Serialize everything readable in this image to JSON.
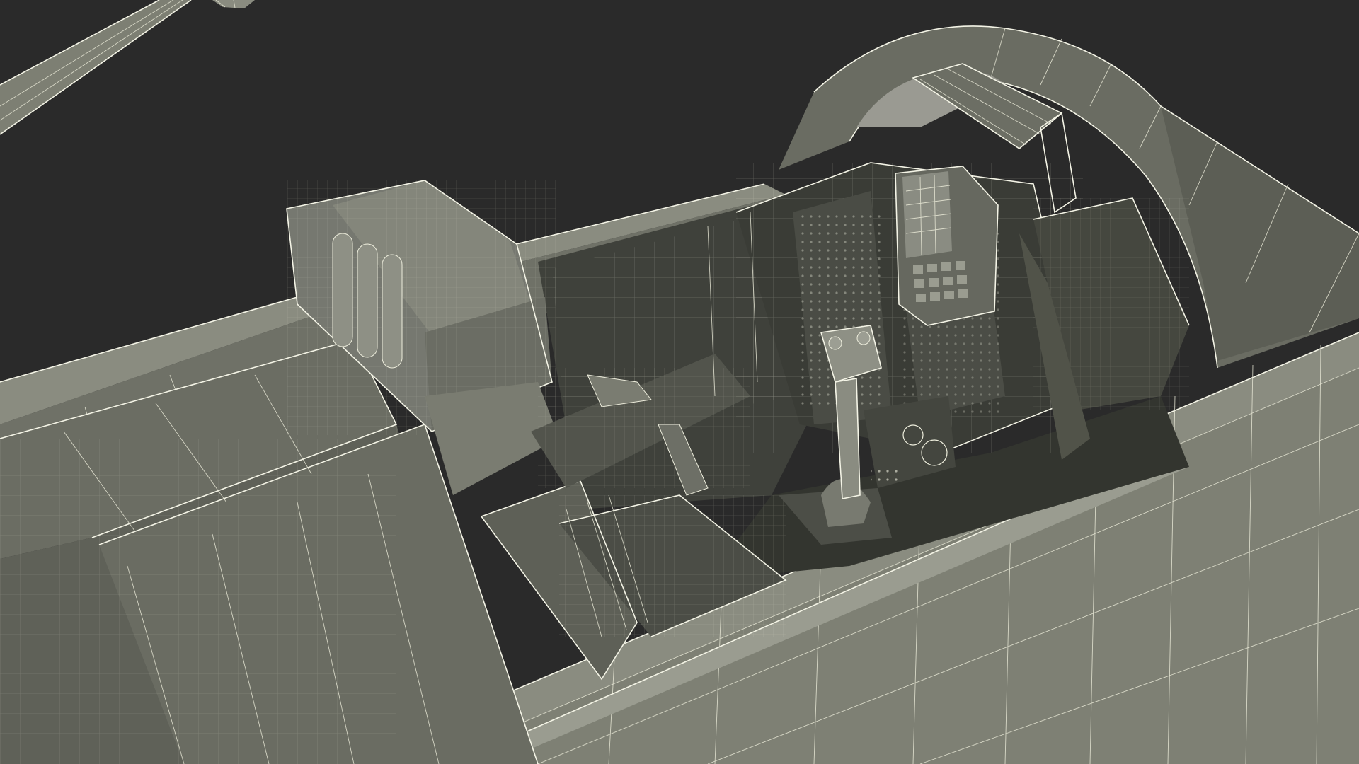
{
  "scene": {
    "background_color": "#2a2a2a",
    "wire_color": "#eeeedd",
    "surface_light": "#7c7e72",
    "surface_mid": "#5e6057",
    "surface_dark": "#3f413b",
    "surface_deep": "#2e302b",
    "screen_glass": "#9a9a92",
    "subject_icon": "fighter-jet-cockpit-wireframe"
  }
}
